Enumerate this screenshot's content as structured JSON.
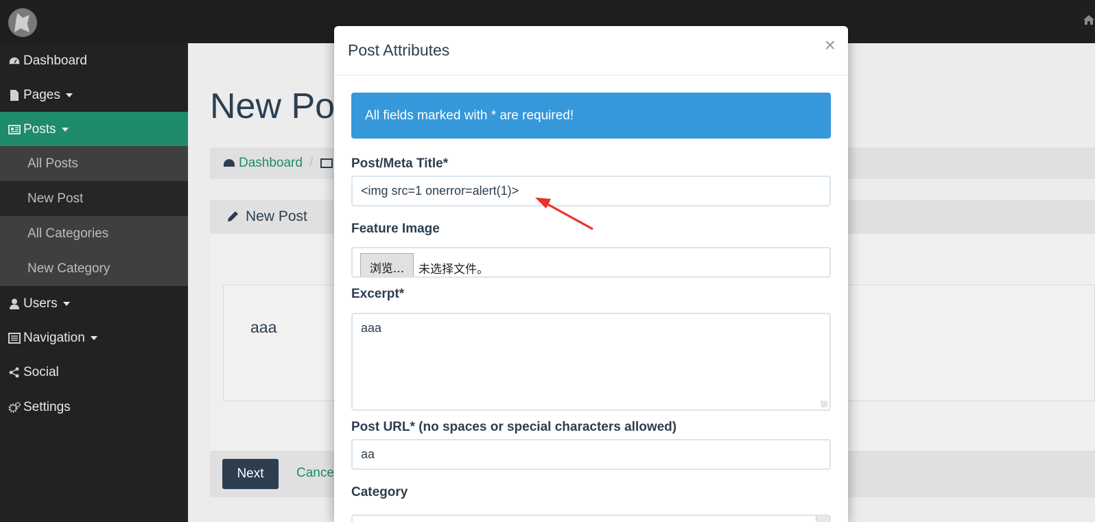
{
  "sidebar": {
    "items": [
      {
        "label": "Dashboard",
        "icon": "dashboard-icon"
      },
      {
        "label": "Pages",
        "icon": "file-icon"
      },
      {
        "label": "Posts",
        "icon": "newspaper-icon"
      },
      {
        "label": "Users",
        "icon": "user-icon"
      },
      {
        "label": "Navigation",
        "icon": "list-icon"
      },
      {
        "label": "Social",
        "icon": "share-icon"
      },
      {
        "label": "Settings",
        "icon": "gears-icon"
      }
    ],
    "sub_items": [
      "All Posts",
      "New Post",
      "All Categories",
      "New Category"
    ]
  },
  "page": {
    "title": "New Pos",
    "breadcrumb": {
      "dashboard": "Dashboard"
    },
    "panel_title": "New Post",
    "editor_text": "aaa",
    "next_label": "Next",
    "cancel_label": "Cancel"
  },
  "modal": {
    "title": "Post Attributes",
    "close": "×",
    "alert": "All fields marked with * are required!",
    "fields": {
      "meta_title_label": "Post/Meta Title*",
      "meta_title_value": "<img src=1 onerror=alert(1)>",
      "feature_image_label": "Feature Image",
      "browse_label": "浏览...",
      "no_file_label": "未选择文件。",
      "excerpt_label": "Excerpt*",
      "excerpt_value": "aaa",
      "url_label": "Post URL* (no spaces or special characters allowed)",
      "url_value": "aa",
      "category_label": "Category"
    }
  },
  "colors": {
    "accent": "#1e8b6b",
    "alert": "#3498db",
    "primary_button": "#2c3e50",
    "annotation_arrow": "#e8312a"
  }
}
